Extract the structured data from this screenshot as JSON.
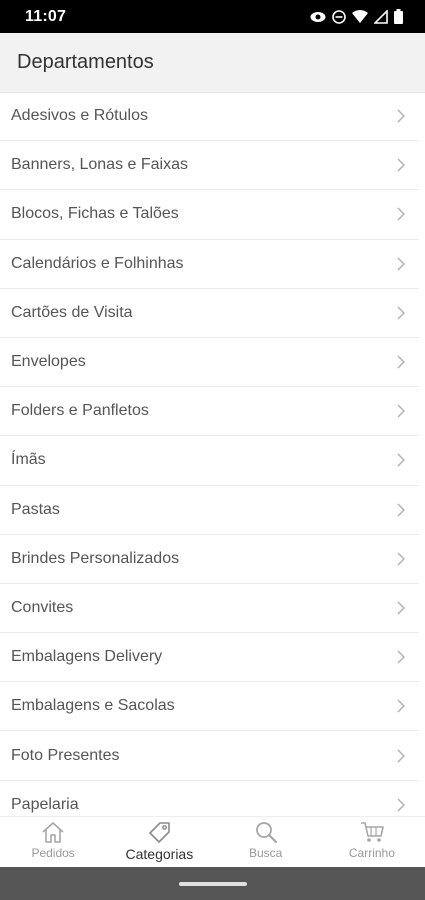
{
  "status_bar": {
    "time": "11:07",
    "icons": [
      "eye-icon",
      "do-not-disturb-icon",
      "wifi-icon",
      "cell-signal-icon",
      "battery-icon"
    ]
  },
  "header": {
    "title": "Departamentos"
  },
  "departments": [
    {
      "label": "Adesivos e Rótulos"
    },
    {
      "label": "Banners, Lonas e Faixas"
    },
    {
      "label": "Blocos, Fichas e Talões"
    },
    {
      "label": "Calendários e Folhinhas"
    },
    {
      "label": "Cartões de Visita"
    },
    {
      "label": "Envelopes"
    },
    {
      "label": "Folders e Panfletos"
    },
    {
      "label": "Ímãs"
    },
    {
      "label": "Pastas"
    },
    {
      "label": "Brindes Personalizados"
    },
    {
      "label": "Convites"
    },
    {
      "label": "Embalagens Delivery"
    },
    {
      "label": "Embalagens e Sacolas"
    },
    {
      "label": "Foto Presentes"
    },
    {
      "label": "Papelaria"
    }
  ],
  "bottom_nav": {
    "items": [
      {
        "label": "Pedidos",
        "icon": "home-icon",
        "active": false
      },
      {
        "label": "Categorias",
        "icon": "tag-icon",
        "active": true
      },
      {
        "label": "Busca",
        "icon": "search-icon",
        "active": false
      },
      {
        "label": "Carrinho",
        "icon": "cart-icon",
        "active": false
      }
    ]
  },
  "colors": {
    "status_bar_bg": "#000000",
    "header_bg": "#f2f2f2",
    "text": "#555555",
    "nav_inactive": "#999999",
    "system_nav_bg": "#555555"
  }
}
